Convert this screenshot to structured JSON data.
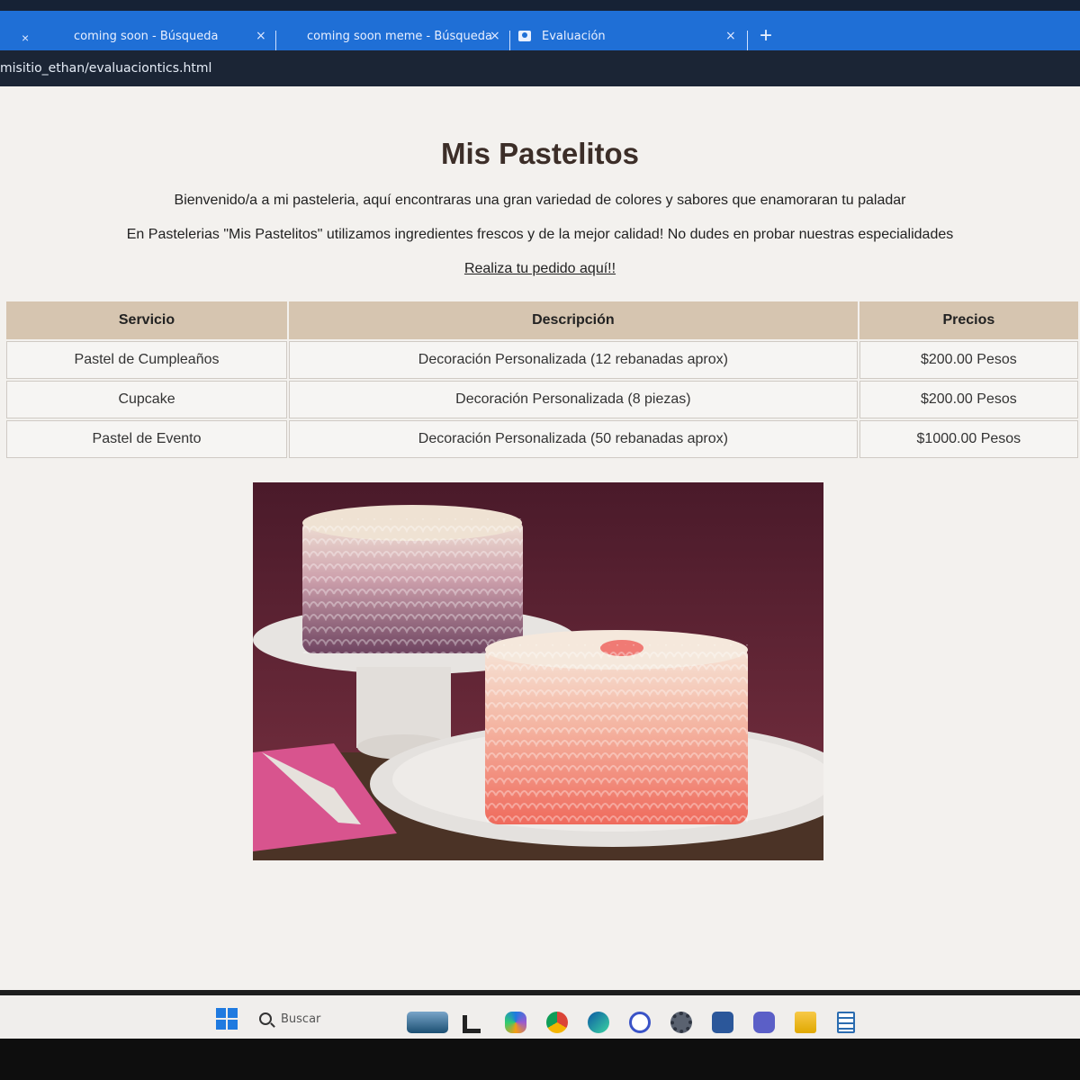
{
  "browser": {
    "tabs": [
      {
        "title": "coming soon - Búsqueda"
      },
      {
        "title": "coming soon meme - Búsqueda"
      },
      {
        "title": "Evaluación"
      }
    ],
    "close_glyph": "×",
    "new_tab_glyph": "+",
    "address": "misitio_ethan/evaluaciontics.html"
  },
  "page": {
    "title": "Mis Pastelitos",
    "intro1": "Bienvenido/a a mi pasteleria, aquí encontraras una gran variedad de colores y sabores que enamoraran tu paladar",
    "intro2": "En Pastelerias \"Mis Pastelitos\" utilizamos ingredientes frescos y de la mejor calidad! No dudes en probar nuestras especialidades",
    "order_link": "Realiza tu pedido aquí!!",
    "table": {
      "headers": [
        "Servicio",
        "Descripción",
        "Precios"
      ],
      "rows": [
        [
          "Pastel de Cumpleaños",
          "Decoración Personalizada (12 rebanadas aprox)",
          "$200.00 Pesos"
        ],
        [
          "Cupcake",
          "Decoración Personalizada (8 piezas)",
          "$200.00 Pesos"
        ],
        [
          "Pastel de Evento",
          "Decoración Personalizada (50 rebanadas aprox)",
          "$1000.00 Pesos"
        ]
      ]
    }
  },
  "taskbar": {
    "search_label": "Buscar",
    "icons": [
      "start-icon",
      "search-icon",
      "widgets-icon",
      "task-view-icon",
      "copilot-icon",
      "chrome-icon",
      "edge-icon",
      "app-circle-icon",
      "settings-icon",
      "word-icon",
      "teams-icon",
      "file-explorer-icon",
      "notepad-icon"
    ]
  },
  "colors": {
    "tab_bar": "#1f6fd6",
    "address_bar": "#1b2535",
    "page_bg": "#f3f1ee",
    "table_header": "#d6c5b0"
  }
}
